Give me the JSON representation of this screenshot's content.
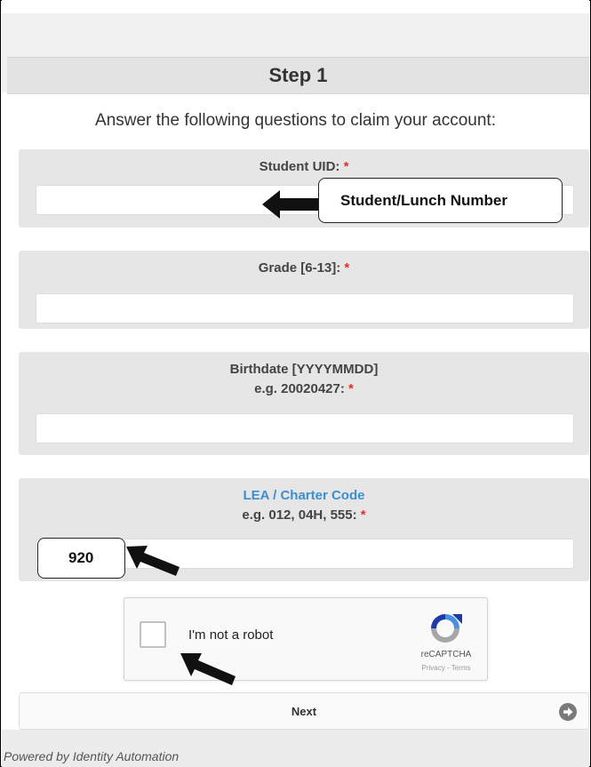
{
  "step": {
    "title": "Step 1"
  },
  "instructions": "Answer the following questions to claim your account:",
  "required_marker": "*",
  "fields": [
    {
      "label": "Student UID:",
      "value": "",
      "placeholder": ""
    },
    {
      "label": "Grade [6-13]:",
      "value": "",
      "placeholder": ""
    },
    {
      "label_line1": "Birthdate [YYYYMMDD]",
      "label_line2": "e.g. 20020427:",
      "value": "",
      "placeholder": ""
    },
    {
      "label_line1": "LEA / Charter Code",
      "label_line2": "e.g. 012, 04H, 555:",
      "value": "",
      "placeholder": ""
    }
  ],
  "callouts": {
    "student_uid": "Student/Lunch Number",
    "lea_code": "920"
  },
  "recaptcha": {
    "label": "I'm not a robot",
    "brand": "reCAPTCHA",
    "links": "Privacy - Terms",
    "checked": false
  },
  "next_button": {
    "label": "Next",
    "icon": "arrow-right-circle-icon"
  },
  "footer": {
    "text": "Powered by Identity Automation"
  },
  "colors": {
    "required": "#e0302e",
    "link": "#3b8fd0",
    "header_bg": "#e3e3e3",
    "field_bg": "#e6e6e6"
  }
}
